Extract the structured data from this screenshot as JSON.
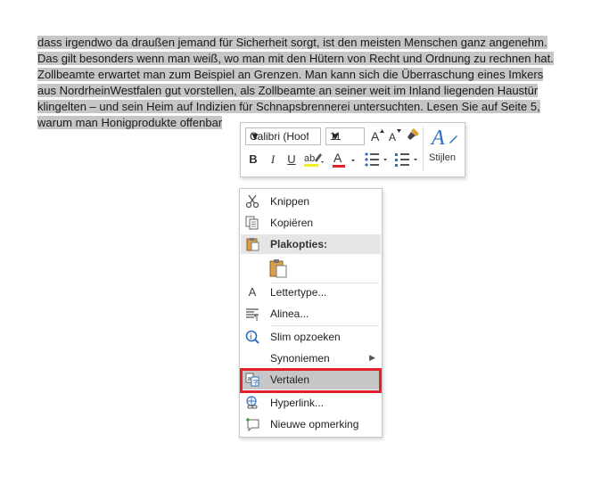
{
  "document": {
    "line1": "dass irgendwo da draußen jemand für Sicherheit sorgt, ist den meisten Menschen ganz angenehm.",
    "line2": "Das gilt besonders wenn man weiß, wo man mit den Hütern von Recht und Ordnung zu rechnen hat.",
    "line3": "Zollbeamte erwartet man zum Beispiel an Grenzen. Man kann sich die Überraschung eines Imkers",
    "line4": "aus NordrheinWestfalen gut vorstellen, als Zollbeamte an seiner weit im Inland liegenden Haustür",
    "line5": "klingelten – und sein Heim auf Indizien für Schnapsbrennerei untersuchten. Lesen Sie auf Seite 5,",
    "line6": "warum man Honigprodukte offenbar"
  },
  "mini_toolbar": {
    "font_name": "Calibri (Hoofdte",
    "font_size": "11",
    "bold": "B",
    "italic": "I",
    "underline": "U",
    "font_color_letter": "A",
    "styles_letter": "A",
    "styles_label": "Stijlen"
  },
  "context_menu": {
    "cut": "Knippen",
    "copy": "Kopiëren",
    "paste_options": "Plakopties:",
    "font": "Lettertype...",
    "paragraph": "Alinea...",
    "smart_lookup": "Slim opzoeken",
    "synonyms": "Synoniemen",
    "translate": "Vertalen",
    "hyperlink": "Hyperlink...",
    "new_comment": "Nieuwe opmerking"
  },
  "colors": {
    "highlight_border": "#e0202a",
    "selection": "#c6c6c6",
    "font_color_bar": "#e0202a"
  }
}
